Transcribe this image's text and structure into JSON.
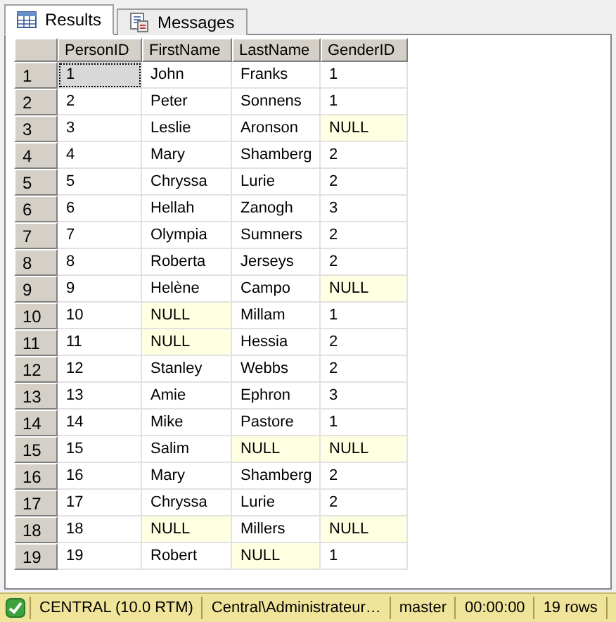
{
  "tabs": [
    {
      "label": "Results",
      "kind": "grid",
      "selected": true
    },
    {
      "label": "Messages",
      "kind": "messages",
      "selected": false
    }
  ],
  "table": {
    "columns": [
      "PersonID",
      "FirstName",
      "LastName",
      "GenderID"
    ],
    "rows": [
      {
        "number": "1",
        "current": true,
        "cells": [
          {
            "text": "1",
            "is_null": false
          },
          {
            "text": "John",
            "is_null": false
          },
          {
            "text": "Franks",
            "is_null": false
          },
          {
            "text": "1",
            "is_null": false
          }
        ]
      },
      {
        "number": "2",
        "current": false,
        "cells": [
          {
            "text": "2",
            "is_null": false
          },
          {
            "text": "Peter",
            "is_null": false
          },
          {
            "text": "Sonnens",
            "is_null": false
          },
          {
            "text": "1",
            "is_null": false
          }
        ]
      },
      {
        "number": "3",
        "current": false,
        "cells": [
          {
            "text": "3",
            "is_null": false
          },
          {
            "text": "Leslie",
            "is_null": false
          },
          {
            "text": "Aronson",
            "is_null": false
          },
          {
            "text": "NULL",
            "is_null": true
          }
        ]
      },
      {
        "number": "4",
        "current": false,
        "cells": [
          {
            "text": "4",
            "is_null": false
          },
          {
            "text": "Mary",
            "is_null": false
          },
          {
            "text": "Shamberg",
            "is_null": false
          },
          {
            "text": "2",
            "is_null": false
          }
        ]
      },
      {
        "number": "5",
        "current": false,
        "cells": [
          {
            "text": "5",
            "is_null": false
          },
          {
            "text": "Chryssa",
            "is_null": false
          },
          {
            "text": "Lurie",
            "is_null": false
          },
          {
            "text": "2",
            "is_null": false
          }
        ]
      },
      {
        "number": "6",
        "current": false,
        "cells": [
          {
            "text": "6",
            "is_null": false
          },
          {
            "text": "Hellah",
            "is_null": false
          },
          {
            "text": "Zanogh",
            "is_null": false
          },
          {
            "text": "3",
            "is_null": false
          }
        ]
      },
      {
        "number": "7",
        "current": false,
        "cells": [
          {
            "text": "7",
            "is_null": false
          },
          {
            "text": "Olympia",
            "is_null": false
          },
          {
            "text": "Sumners",
            "is_null": false
          },
          {
            "text": "2",
            "is_null": false
          }
        ]
      },
      {
        "number": "8",
        "current": false,
        "cells": [
          {
            "text": "8",
            "is_null": false
          },
          {
            "text": "Roberta",
            "is_null": false
          },
          {
            "text": "Jerseys",
            "is_null": false
          },
          {
            "text": "2",
            "is_null": false
          }
        ]
      },
      {
        "number": "9",
        "current": false,
        "cells": [
          {
            "text": "9",
            "is_null": false
          },
          {
            "text": "Helène",
            "is_null": false
          },
          {
            "text": "Campo",
            "is_null": false
          },
          {
            "text": "NULL",
            "is_null": true
          }
        ]
      },
      {
        "number": "10",
        "current": false,
        "cells": [
          {
            "text": "10",
            "is_null": false
          },
          {
            "text": "NULL",
            "is_null": true
          },
          {
            "text": "Millam",
            "is_null": false
          },
          {
            "text": "1",
            "is_null": false
          }
        ]
      },
      {
        "number": "11",
        "current": false,
        "cells": [
          {
            "text": "11",
            "is_null": false
          },
          {
            "text": "NULL",
            "is_null": true
          },
          {
            "text": "Hessia",
            "is_null": false
          },
          {
            "text": "2",
            "is_null": false
          }
        ]
      },
      {
        "number": "12",
        "current": false,
        "cells": [
          {
            "text": "12",
            "is_null": false
          },
          {
            "text": "Stanley",
            "is_null": false
          },
          {
            "text": "Webbs",
            "is_null": false
          },
          {
            "text": "2",
            "is_null": false
          }
        ]
      },
      {
        "number": "13",
        "current": false,
        "cells": [
          {
            "text": "13",
            "is_null": false
          },
          {
            "text": "Amie",
            "is_null": false
          },
          {
            "text": "Ephron",
            "is_null": false
          },
          {
            "text": "3",
            "is_null": false
          }
        ]
      },
      {
        "number": "14",
        "current": false,
        "cells": [
          {
            "text": "14",
            "is_null": false
          },
          {
            "text": "Mike",
            "is_null": false
          },
          {
            "text": "Pastore",
            "is_null": false
          },
          {
            "text": "1",
            "is_null": false
          }
        ]
      },
      {
        "number": "15",
        "current": false,
        "cells": [
          {
            "text": "15",
            "is_null": false
          },
          {
            "text": "Salim",
            "is_null": false
          },
          {
            "text": "NULL",
            "is_null": true
          },
          {
            "text": "NULL",
            "is_null": true
          }
        ]
      },
      {
        "number": "16",
        "current": false,
        "cells": [
          {
            "text": "16",
            "is_null": false
          },
          {
            "text": "Mary",
            "is_null": false
          },
          {
            "text": "Shamberg",
            "is_null": false
          },
          {
            "text": "2",
            "is_null": false
          }
        ]
      },
      {
        "number": "17",
        "current": false,
        "cells": [
          {
            "text": "17",
            "is_null": false
          },
          {
            "text": "Chryssa",
            "is_null": false
          },
          {
            "text": "Lurie",
            "is_null": false
          },
          {
            "text": "2",
            "is_null": false
          }
        ]
      },
      {
        "number": "18",
        "current": false,
        "cells": [
          {
            "text": "18",
            "is_null": false
          },
          {
            "text": "NULL",
            "is_null": true
          },
          {
            "text": "Millers",
            "is_null": false
          },
          {
            "text": "NULL",
            "is_null": true
          }
        ]
      },
      {
        "number": "19",
        "current": false,
        "cells": [
          {
            "text": "19",
            "is_null": false
          },
          {
            "text": "Robert",
            "is_null": false
          },
          {
            "text": "NULL",
            "is_null": true
          },
          {
            "text": "1",
            "is_null": false
          }
        ]
      }
    ]
  },
  "status_bar": {
    "succeeded": true,
    "fields": [
      "CENTRAL (10.0 RTM)",
      "Central\\Administrateur…",
      "master",
      "00:00:00",
      "19 rows"
    ]
  }
}
